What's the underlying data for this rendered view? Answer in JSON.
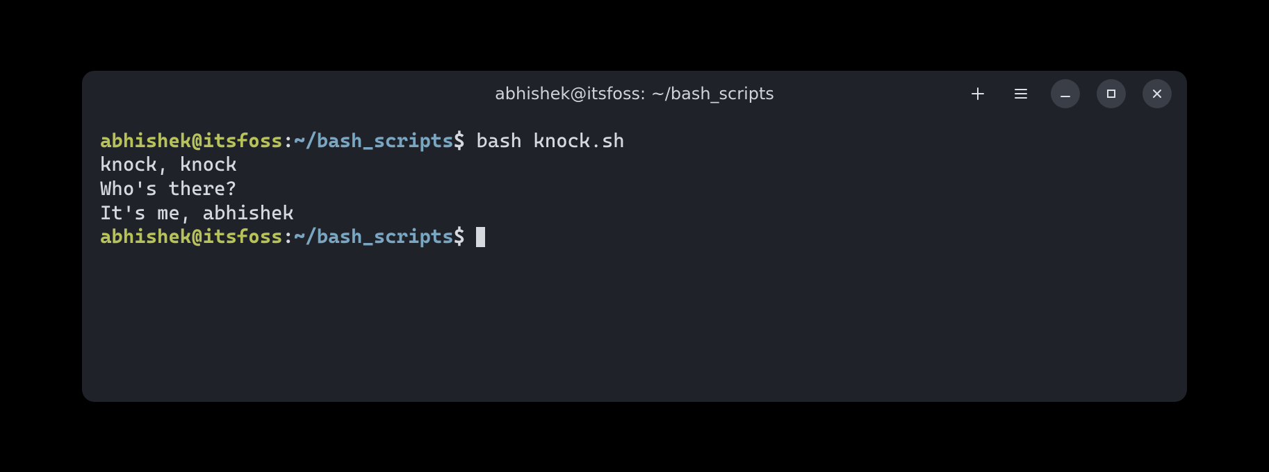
{
  "window": {
    "title": "abhishek@itsfoss: ~/bash_scripts"
  },
  "prompt": {
    "user_host": "abhishek@itsfoss",
    "colon": ":",
    "cwd": "~/bash_scripts",
    "dollar": "$"
  },
  "lines": {
    "cmd1": " bash knock.sh",
    "out1": "knock, knock",
    "out2": "Who's there?",
    "out3": "It's me, abhishek",
    "cmd2": " "
  }
}
